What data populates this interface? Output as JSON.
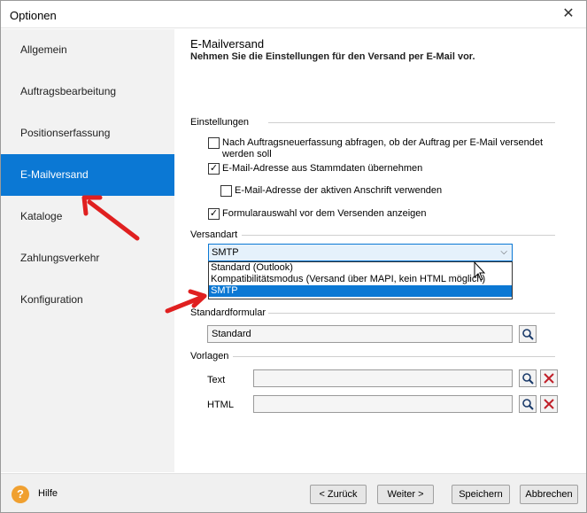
{
  "window": {
    "title": "Optionen",
    "close_glyph": "✕"
  },
  "sidebar": {
    "items": [
      {
        "label": "Allgemein"
      },
      {
        "label": "Auftragsbearbeitung"
      },
      {
        "label": "Positionserfassung"
      },
      {
        "label": "E-Mailversand",
        "active": true
      },
      {
        "label": "Kataloge"
      },
      {
        "label": "Zahlungsverkehr"
      },
      {
        "label": "Konfiguration"
      }
    ]
  },
  "main": {
    "title": "E-Mailversand",
    "subtitle": "Nehmen Sie die Einstellungen für den Versand per E-Mail vor.",
    "settings": {
      "label": "Einstellungen",
      "checkboxes": [
        {
          "label_line1": "Nach Auftragsneuerfassung abfragen, ob der Auftrag per E-Mail versendet",
          "label_line2": "werden soll",
          "checked": false
        },
        {
          "label": "E-Mail-Adresse aus Stammdaten übernehmen",
          "checked": true
        },
        {
          "label": "E-Mail-Adresse der aktiven Anschrift verwenden",
          "checked": false
        },
        {
          "label": "Formularauswahl vor dem Versenden anzeigen",
          "checked": true
        }
      ]
    },
    "versandart": {
      "label": "Versandart",
      "selected": "SMTP",
      "options": [
        "Standard (Outlook)",
        "Kompatibilitätsmodus (Versand über MAPI, kein HTML möglich)",
        "SMTP"
      ]
    },
    "standardformular": {
      "label": "Standardformular",
      "value": "Standard"
    },
    "vorlagen": {
      "label": "Vorlagen",
      "text_label": "Text",
      "text_value": "",
      "html_label": "HTML",
      "html_value": ""
    }
  },
  "footer": {
    "help_label": "Hilfe",
    "back_label": "< Zurück",
    "next_label": "Weiter >",
    "save_label": "Speichern",
    "cancel_label": "Abbrechen"
  },
  "colors": {
    "accent": "#0b78d4",
    "annotation_arrow": "#e02020",
    "help_icon": "#f0a030"
  },
  "icons": {
    "search": "magnifier-icon",
    "delete": "red-x-icon",
    "help": "question-icon",
    "check": "✓",
    "dropdown": "⌵"
  }
}
